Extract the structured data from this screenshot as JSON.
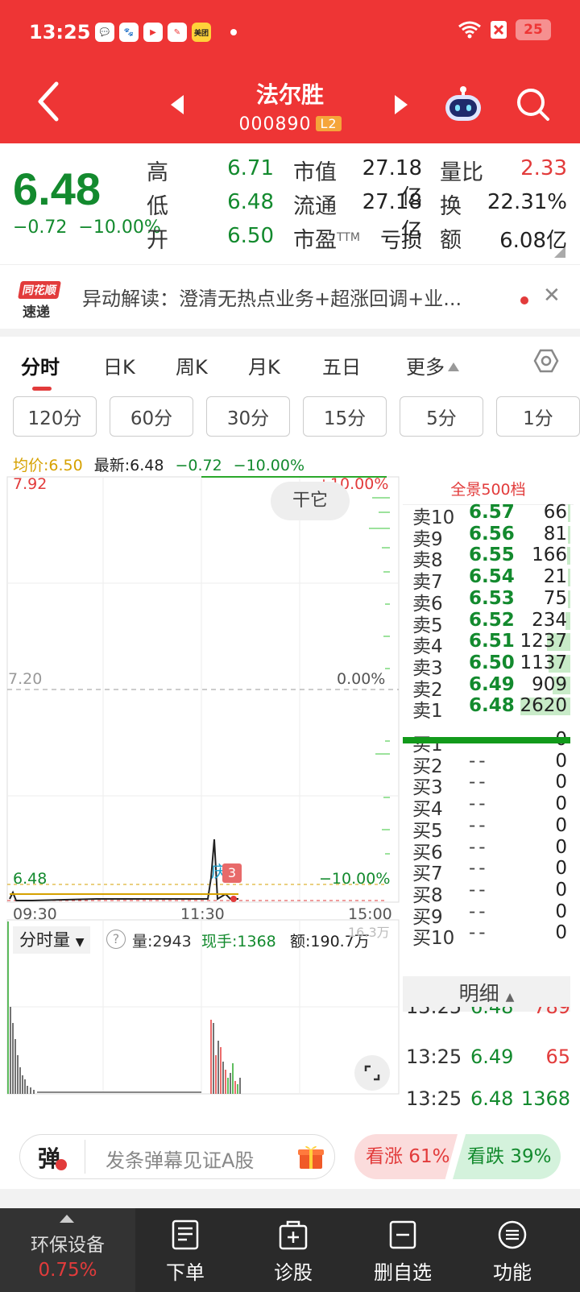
{
  "status": {
    "time": "13:25",
    "apps": [
      "💬",
      "🐾",
      "▶",
      "✎",
      "美团"
    ],
    "battery": "25"
  },
  "stock": {
    "name": "法尔胜",
    "code": "000890",
    "level_badge": "L2",
    "price": "6.48",
    "change": "−0.72",
    "change_pct": "−10.00%"
  },
  "quote": {
    "high_label": "高",
    "high": "6.71",
    "low_label": "低",
    "low": "6.48",
    "open_label": "开",
    "open": "6.50",
    "mcap_label": "市值",
    "mcap": "27.18亿",
    "float_label": "流通",
    "float": "27.18亿",
    "pe_label": "市盈",
    "pe_tm": "TTM",
    "pe": "亏损",
    "vol_ratio_label": "量比",
    "vol_ratio": "2.33",
    "turnover_label": "换",
    "turnover": "22.31%",
    "amount_label": "额",
    "amount": "6.08亿"
  },
  "news": {
    "logo_top": "同花顺",
    "logo_bottom": "速递",
    "text": "异动解读：澄清无热点业务+超涨回调+业..."
  },
  "tabs": [
    "分时",
    "日K",
    "周K",
    "月K",
    "五日",
    "更多"
  ],
  "periods": [
    "120分",
    "60分",
    "30分",
    "15分",
    "5分",
    "1分"
  ],
  "infobar": {
    "avg": "均价:6.50",
    "latest": "最新:6.48",
    "chg": "−0.72",
    "pct": "−10.00%"
  },
  "chart": {
    "y_top": "7.92",
    "y_top_pct": "+10.00%",
    "y_mid": "7.20",
    "y_mid_pct": "0.00%",
    "y_low": "6.48",
    "y_low_pct": "−10.00%",
    "x_start": "09:30",
    "x_mid": "11:30",
    "x_end": "15:00",
    "float_button": "干它",
    "marker_text": "庆",
    "marker_badge": "3"
  },
  "volume_bar": {
    "dropdown": "分时量",
    "help": "?",
    "vol": "量:2943",
    "now_hand": "现手:1368",
    "amount": "额:190.7万",
    "ghost": "16.3万"
  },
  "orderbook": {
    "title": "全景500档",
    "asks": [
      {
        "name": "卖10",
        "price": "6.57",
        "vol": "66",
        "bar": 0.03
      },
      {
        "name": "卖9",
        "price": "6.56",
        "vol": "81",
        "bar": 0.03
      },
      {
        "name": "卖8",
        "price": "6.55",
        "vol": "166",
        "bar": 0.06
      },
      {
        "name": "卖7",
        "price": "6.54",
        "vol": "21",
        "bar": 0.01
      },
      {
        "name": "卖6",
        "price": "6.53",
        "vol": "75",
        "bar": 0.03
      },
      {
        "name": "卖5",
        "price": "6.52",
        "vol": "234",
        "bar": 0.09
      },
      {
        "name": "卖4",
        "price": "6.51",
        "vol": "1237",
        "bar": 0.47
      },
      {
        "name": "卖3",
        "price": "6.50",
        "vol": "1137",
        "bar": 0.43
      },
      {
        "name": "卖2",
        "price": "6.49",
        "vol": "909",
        "bar": 0.35
      },
      {
        "name": "卖1",
        "price": "6.48",
        "vol": "2620",
        "bar": 1.0
      }
    ],
    "bids": [
      {
        "name": "买1",
        "price": "--",
        "vol": "0"
      },
      {
        "name": "买2",
        "price": "--",
        "vol": "0"
      },
      {
        "name": "买3",
        "price": "--",
        "vol": "0"
      },
      {
        "name": "买4",
        "price": "--",
        "vol": "0"
      },
      {
        "name": "买5",
        "price": "--",
        "vol": "0"
      },
      {
        "name": "买6",
        "price": "--",
        "vol": "0"
      },
      {
        "name": "买7",
        "price": "--",
        "vol": "0"
      },
      {
        "name": "买8",
        "price": "--",
        "vol": "0"
      },
      {
        "name": "买9",
        "price": "--",
        "vol": "0"
      },
      {
        "name": "买10",
        "price": "--",
        "vol": "0"
      }
    ]
  },
  "detail": {
    "title": "明细",
    "rows": [
      {
        "time": "13:25",
        "price": "6.48",
        "vol": "789"
      },
      {
        "time": "13:25",
        "price": "6.49",
        "vol": "65"
      },
      {
        "time": "13:25",
        "price": "6.48",
        "vol": "1368"
      }
    ]
  },
  "danmu": {
    "icon": "弹",
    "placeholder": "发条弹幕见证A股"
  },
  "vote": {
    "up": "看涨 61%",
    "down": "看跌 39%"
  },
  "bottom": {
    "sector": "环保设备",
    "sector_pct": "0.75%",
    "items": [
      "下单",
      "诊股",
      "删自选",
      "功能"
    ]
  },
  "colors": {
    "brand_red": "#ee3535",
    "down_green": "#138a2e",
    "up_red": "#e23b3b",
    "avg_yellow": "#d6a100"
  }
}
